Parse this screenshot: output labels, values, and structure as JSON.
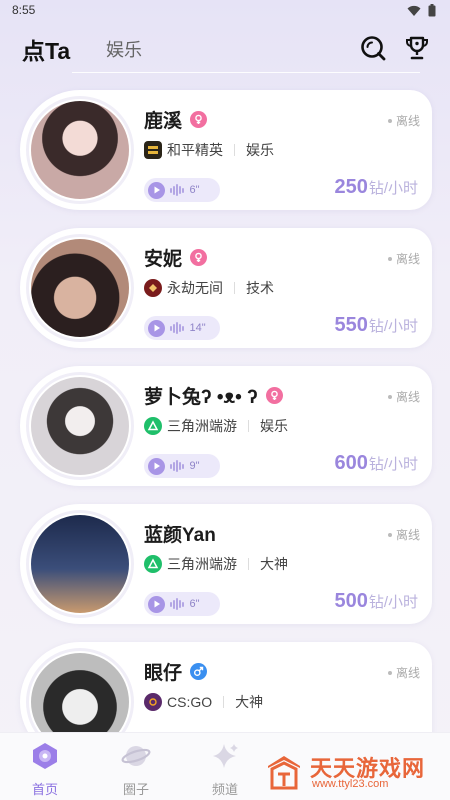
{
  "status_bar": {
    "time": "8:55"
  },
  "header": {
    "tabs": [
      {
        "label": "点Ta",
        "active": true
      },
      {
        "label": "娱乐",
        "active": false
      }
    ],
    "icons": [
      "search-icon",
      "trophy-icon"
    ]
  },
  "profiles": [
    {
      "name": "鹿溪",
      "gender": "female",
      "status": "离线",
      "game": "和平精英",
      "game_icon": "peace-elite-game-icon",
      "category": "娱乐",
      "voice_duration": "6\"",
      "price": "250",
      "price_unit": "钻/小时",
      "avatar_color": "#c9a9a6"
    },
    {
      "name": "安妮",
      "gender": "female",
      "status": "离线",
      "game": "永劫无间",
      "game_icon": "naraka-game-icon",
      "category": "技术",
      "voice_duration": "14\"",
      "price": "550",
      "price_unit": "钻/小时",
      "avatar_color": "#b28a79"
    },
    {
      "name": "萝卜兔ʔ •ᴥ• ʔ",
      "gender": "female",
      "status": "离线",
      "game": "三角洲端游",
      "game_icon": "delta-force-game-icon",
      "category": "娱乐",
      "voice_duration": "9\"",
      "price": "600",
      "price_unit": "钻/小时",
      "avatar_color": "#d8d4d8"
    },
    {
      "name": "蓝颜Yan",
      "gender": "male",
      "status": "离线",
      "game": "三角洲端游",
      "game_icon": "delta-force-game-icon",
      "category": "大神",
      "voice_duration": "6\"",
      "price": "500",
      "price_unit": "钻/小时",
      "avatar_color": "#3b4e7a"
    },
    {
      "name": "眼仔",
      "gender": "male",
      "status": "离线",
      "game": "CS:GO",
      "game_icon": "csgo-game-icon",
      "category": "大神",
      "voice_duration": "",
      "price": "",
      "price_unit": "",
      "avatar_color": "#6b6b6b"
    }
  ],
  "colors": {
    "accent": "#9a86dd",
    "female_badge": "#f26fa0",
    "male_badge": "#3a8ff0",
    "delta_green": "#1fbf6a"
  },
  "bottom_nav": [
    {
      "label": "首页",
      "icon": "home-icon",
      "active": true
    },
    {
      "label": "圈子",
      "icon": "planet-icon",
      "active": false
    },
    {
      "label": "频道",
      "icon": "sparkle-icon",
      "active": false
    }
  ],
  "watermark": {
    "text": "天天游戏网",
    "url": "www.ttyl23.com"
  }
}
